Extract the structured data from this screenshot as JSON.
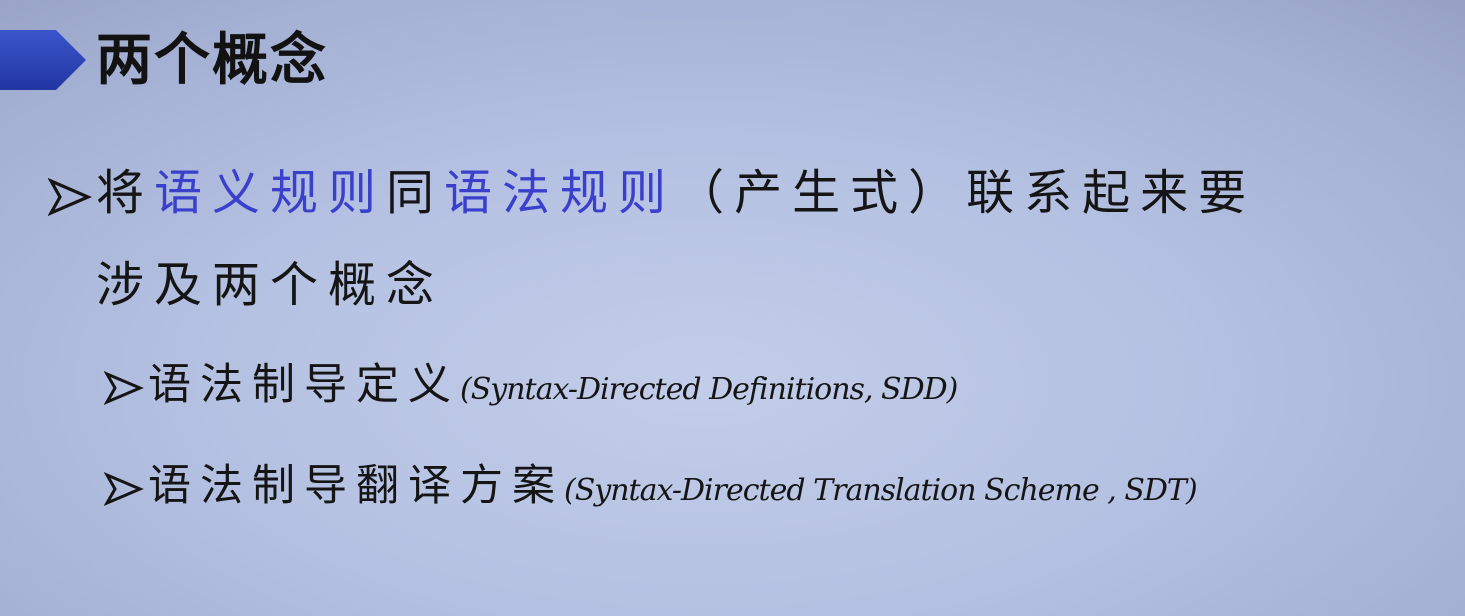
{
  "slide": {
    "title": "两个概念",
    "bullet1": {
      "line1": {
        "prefix": "将",
        "highlight1": "语义规则",
        "mid": "同",
        "highlight2": "语法规则",
        "suffix": "（产生式）联系起来要"
      },
      "line2": "涉及两个概念"
    },
    "sub_bullets": [
      {
        "label": "语法制导定义",
        "paren": "(Syntax-Directed Definitions, SDD)"
      },
      {
        "label": "语法制导翻译方案",
        "paren": "(Syntax-Directed Translation Scheme , SDT)"
      }
    ]
  },
  "colors": {
    "title_bar": "#2b44b8",
    "highlight": "#3a3fcc",
    "text": "#151515"
  },
  "icons": {
    "title_marker": "blue-pentagon-arrow",
    "bullet": "hollow-arrowhead-bullet"
  }
}
